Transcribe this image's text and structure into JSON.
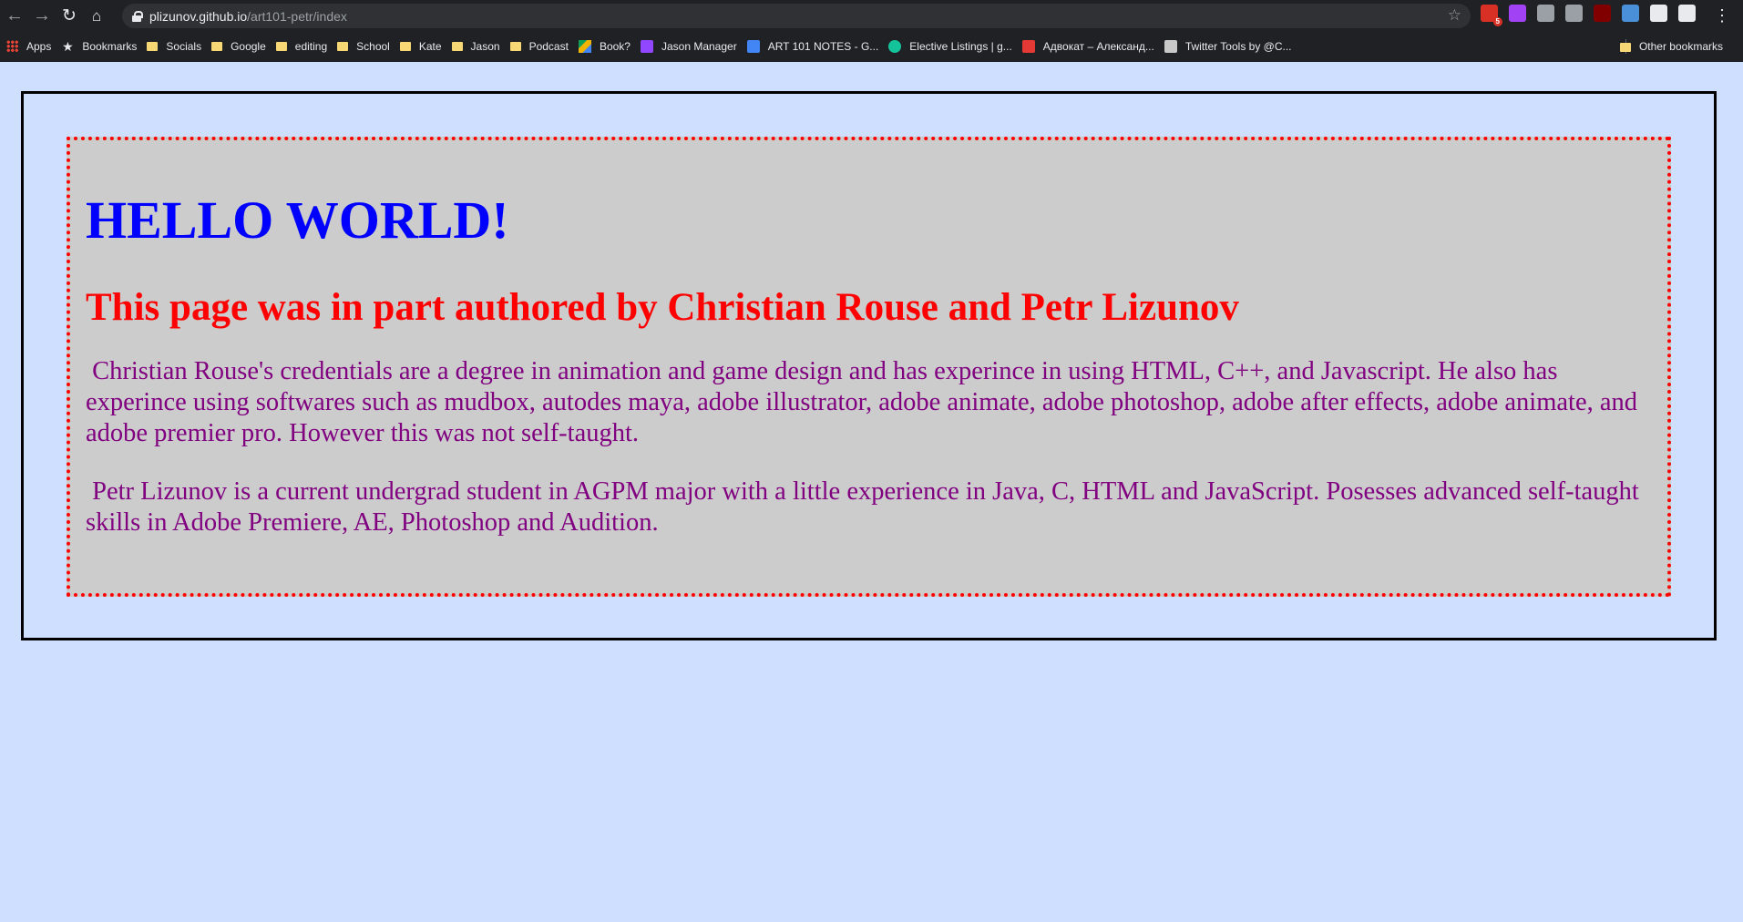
{
  "browser": {
    "url_host": "plizunov.github.io",
    "url_path": "/art101-petr/index",
    "extensions": [
      {
        "name": "gmail-extension-icon",
        "color": "#d93025",
        "badge": "5"
      },
      {
        "name": "purple-extension-icon",
        "color": "#a142f4"
      },
      {
        "name": "mute-tab-icon",
        "color": "#9aa0a6"
      },
      {
        "name": "mail-envelope-icon",
        "color": "#9aa0a6"
      },
      {
        "name": "ublock-icon",
        "color": "#800000"
      },
      {
        "name": "iq-extension-icon",
        "color": "#4a90d9"
      },
      {
        "name": "extensions-puzzle-icon",
        "color": "#e8eaed"
      },
      {
        "name": "profile-avatar-icon",
        "color": "#e8eaed"
      }
    ]
  },
  "bookmarks": [
    {
      "label": "Apps",
      "icon": "apps-grid-icon"
    },
    {
      "label": "Bookmarks",
      "icon": "star-icon"
    },
    {
      "label": "Socials",
      "icon": "folder-icon"
    },
    {
      "label": "Google",
      "icon": "folder-icon"
    },
    {
      "label": "editing",
      "icon": "folder-icon"
    },
    {
      "label": "School",
      "icon": "folder-icon"
    },
    {
      "label": "Kate",
      "icon": "folder-icon"
    },
    {
      "label": "Jason",
      "icon": "folder-icon"
    },
    {
      "label": "Podcast",
      "icon": "folder-icon"
    },
    {
      "label": "Book?",
      "icon": "google-drive-icon"
    },
    {
      "label": "Jason Manager",
      "icon": "twitch-icon"
    },
    {
      "label": "ART 101 NOTES - G...",
      "icon": "google-docs-icon"
    },
    {
      "label": "Elective Listings | g...",
      "icon": "grammarly-icon"
    },
    {
      "label": "Адвокат – Александ...",
      "icon": "mm-logo-icon"
    },
    {
      "label": "Twitter Tools by @C...",
      "icon": "twitter-tools-icon"
    }
  ],
  "other_bookmarks": "Other bookmarks",
  "page": {
    "heading": "HELLO WORLD!",
    "subheading": "This page was in part authored by Christian Rouse and Petr Lizunov",
    "paragraph1": " Christian Rouse's credentials are a degree in animation and game design and has experince in using HTML, C++, and Javascript. He also has experince using softwares such as mudbox, autodes maya, adobe illustrator, adobe animate, adobe photoshop, adobe after effects, adobe animate, and adobe premier pro. However this was not self-taught.",
    "paragraph2": " Petr Lizunov is a current undergrad student in AGPM major with a little experience in Java, C, HTML and JavaScript. Posesses advanced self-taught skills in Adobe Premiere, AE, Photoshop and Audition."
  }
}
